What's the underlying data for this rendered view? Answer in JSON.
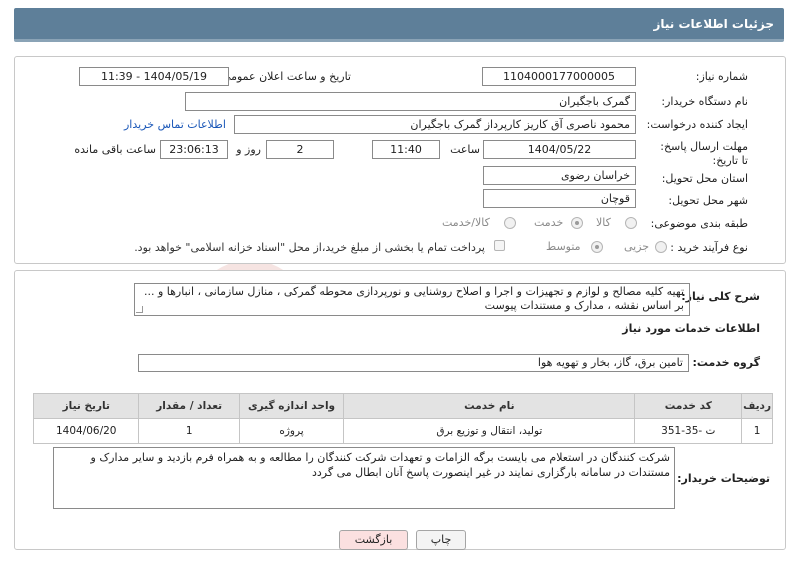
{
  "header": {
    "title": "جزئیات اطلاعات نیاز"
  },
  "form": {
    "need_number_label": "شماره نیاز:",
    "need_number": "1104000177000005",
    "announce_label": "تاریخ و ساعت اعلان عمومی:",
    "announce_value": "1404/05/19 - 11:39",
    "buyer_org_label": "نام دستگاه خریدار:",
    "buyer_org": "گمرک باجگیران",
    "requester_label": "ایجاد کننده درخواست:",
    "requester": "محمود ناصری آق کاریز کارپرداز گمرک باجگیران",
    "contact_link": "اطلاعات تماس خریدار",
    "deadline_label": "مهلت ارسال پاسخ: تا تاریخ:",
    "deadline_date": "1404/05/22",
    "time_label": "ساعت",
    "deadline_time": "11:40",
    "days_value": "2",
    "days_label": "روز و",
    "remaining_time": "23:06:13",
    "remaining_label": "ساعت باقی مانده",
    "province_label": "استان محل تحویل:",
    "province": "خراسان رضوی",
    "city_label": "شهر محل تحویل:",
    "city": "قوچان",
    "category_label": "طبقه بندی موضوعی:",
    "category_options": [
      "کالا",
      "خدمت",
      "کالا/خدمت"
    ],
    "category_selected": "خدمت",
    "process_label": "نوع فرآیند خرید :",
    "process_options": [
      "جزیی",
      "متوسط"
    ],
    "process_selected": "متوسط",
    "payment_note": "پرداخت تمام یا بخشی از مبلغ خرید،از محل \"اسناد خزانه اسلامی\" خواهد بود."
  },
  "description": {
    "label": "شرح کلی نیاز:",
    "text": "تهیه کلیه مصالح و لوازم و تجهیزات و اجرا و اصلاح روشنایی و نورپردازی محوطه گمرکی ، منازل سازمانی ، انبارها و ... بر اساس نقشه ، مدارک و مستندات پیوست"
  },
  "services": {
    "section_title": "اطلاعات خدمات مورد نیاز",
    "group_label": "گروه خدمت:",
    "group_value": "تامین برق، گاز، بخار و تهویه هوا",
    "columns": [
      "ردیف",
      "کد خدمت",
      "نام خدمت",
      "واحد اندازه گیری",
      "تعداد / مقدار",
      "تاریخ نیاز"
    ],
    "rows": [
      [
        "1",
        "ت -35-351",
        "تولید، انتقال و توزیع برق",
        "پروژه",
        "1",
        "1404/06/20"
      ]
    ]
  },
  "buyer_notes": {
    "label": "توضیحات خریدار:",
    "text": "شرکت کنندگان در استعلام می بایست برگه الزامات و تعهدات شرکت کنندگان را مطالعه و به همراه فرم بازدید و سایر مدارک و مستندات در سامانه بارگزاری نمایند در غیر اینصورت پاسخ آنان ابطال می گردد"
  },
  "buttons": {
    "print": "چاپ",
    "back": "بازگشت"
  },
  "colors": {
    "header_bg": "#5e7f99",
    "link": "#1a57b8",
    "back_btn_bg": "#fbe0e0"
  }
}
